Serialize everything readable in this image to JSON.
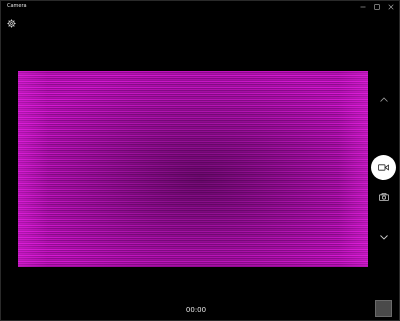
{
  "window": {
    "title": "Camera"
  },
  "controls": {
    "settings_icon": "gear-icon",
    "scroll_up_icon": "chevron-up-icon",
    "scroll_down_icon": "chevron-down-icon",
    "video_mode_icon": "video-camera-icon",
    "photo_mode_icon": "camera-icon"
  },
  "recording": {
    "timer": "00:00"
  },
  "colors": {
    "preview_magenta": "#c412c0",
    "preview_dark": "#8e0c8f",
    "background": "#000000",
    "video_button_bg": "#ffffff",
    "thumbnail_bg": "#4a4a4a"
  }
}
